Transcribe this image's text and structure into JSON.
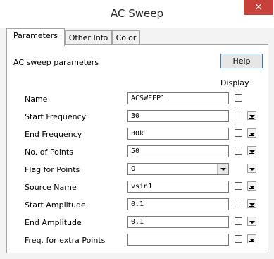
{
  "window": {
    "title": "AC Sweep",
    "close_glyph": "×"
  },
  "tabs": [
    {
      "label": "Parameters",
      "active": true
    },
    {
      "label": "Other Info",
      "active": false
    },
    {
      "label": "Color",
      "active": false
    }
  ],
  "section": {
    "title": "AC sweep parameters",
    "help_label": "Help",
    "display_label": "Display"
  },
  "rows": [
    {
      "label": "Name",
      "value": "ACSWEEP1",
      "checked": false,
      "has_spin": false
    },
    {
      "label": "Start Frequency",
      "value": "30",
      "checked": false,
      "has_spin": true
    },
    {
      "label": "End Frequency",
      "value": "30k",
      "checked": false,
      "has_spin": true
    },
    {
      "label": "No. of Points",
      "value": "50",
      "checked": false,
      "has_spin": true
    },
    {
      "label": "Flag for Points",
      "value": "0",
      "type": "select",
      "has_spin": true
    },
    {
      "label": "Source Name",
      "value": "vsin1",
      "checked": false,
      "has_spin": true
    },
    {
      "label": "Start Amplitude",
      "value": "0.1",
      "checked": false,
      "has_spin": true
    },
    {
      "label": "End Amplitude",
      "value": "0.1",
      "checked": false,
      "has_spin": true
    },
    {
      "label": "Freq. for extra Points",
      "value": "",
      "checked": false,
      "has_spin": true
    }
  ],
  "colors": {
    "close_button": "#c7413a",
    "help_border": "#3c7fb1"
  },
  "icons": {
    "close": "close-icon",
    "dropdown": "chevron-down-icon",
    "spin": "dropdown-icon"
  }
}
